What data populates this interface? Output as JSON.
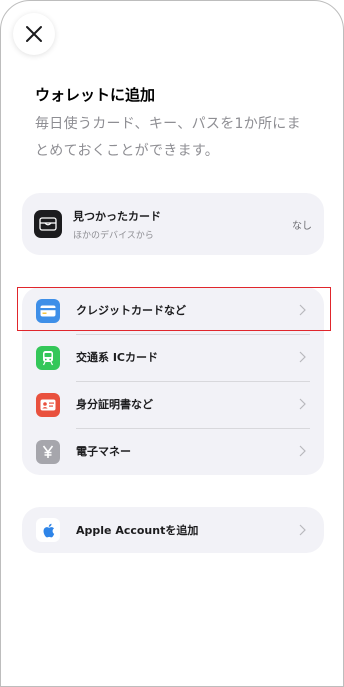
{
  "header": {
    "title": "ウォレットに追加",
    "subtitle": "毎日使うカード、キー、パスを1か所にまとめておくことができます。"
  },
  "found_cards": {
    "title": "見つかったカード",
    "subtitle": "ほかのデバイスから",
    "status": "なし"
  },
  "card_types": [
    {
      "label": "クレジットカードなど",
      "icon": "credit-card-icon",
      "color": "#3e8fe8",
      "selected": true
    },
    {
      "label": "交通系 ICカード",
      "icon": "train-icon",
      "color": "#34c759",
      "selected": false
    },
    {
      "label": "身分証明書など",
      "icon": "id-card-icon",
      "color": "#e9513e",
      "selected": false
    },
    {
      "label": "電子マネー",
      "icon": "yen-icon",
      "color": "#a6a6ac",
      "selected": false
    }
  ],
  "apple_account": {
    "label": "Apple Accountを追加",
    "icon": "apple-logo-icon"
  },
  "colors": {
    "background": "#ffffff",
    "card_background": "#f2f2f7",
    "highlight": "#e0262c",
    "secondary_text": "#8e8e93"
  }
}
